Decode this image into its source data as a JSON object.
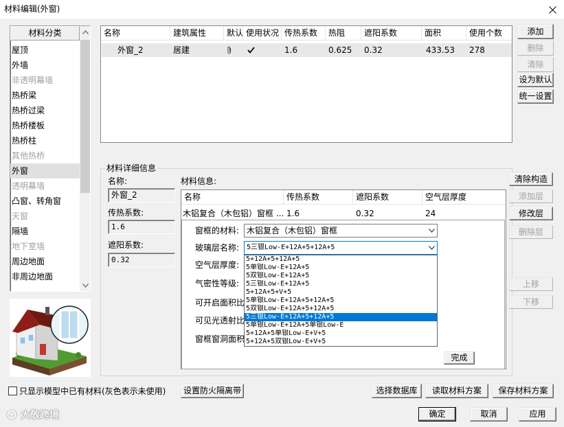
{
  "window": {
    "title": "材料编辑(外窗)"
  },
  "category_list": {
    "header": "材料分类",
    "selected_index": 8,
    "items": [
      {
        "label": "屋顶",
        "used": true
      },
      {
        "label": "外墙",
        "used": true
      },
      {
        "label": "非透明幕墙",
        "used": false
      },
      {
        "label": "热桥梁",
        "used": true
      },
      {
        "label": "热桥过梁",
        "used": true
      },
      {
        "label": "热桥楼板",
        "used": true
      },
      {
        "label": "热桥柱",
        "used": true
      },
      {
        "label": "其他热桥",
        "used": false
      },
      {
        "label": "外窗",
        "used": true
      },
      {
        "label": "透明幕墙",
        "used": false
      },
      {
        "label": "凸窗、转角窗",
        "used": true
      },
      {
        "label": "天窗",
        "used": false
      },
      {
        "label": "隔墙",
        "used": true
      },
      {
        "label": "地下室墙",
        "used": false
      },
      {
        "label": "周边地面",
        "used": true
      },
      {
        "label": "非周边地面",
        "used": true
      }
    ]
  },
  "materials_table": {
    "columns": [
      "名称",
      "建筑属性",
      "默认",
      "使用状况",
      "传热系数",
      "热阻",
      "遮阳系数",
      "面积",
      "使用个数"
    ],
    "rows": [
      {
        "name": "外窗_2",
        "attr": "居建",
        "default_icon": "paperclip-icon",
        "status_icon": "checkmark-icon",
        "u_value": "1.6",
        "resistance": "0.625",
        "shading": "0.32",
        "area": "433.53",
        "count": "278"
      }
    ]
  },
  "material_buttons": {
    "add": "添加",
    "delete": "删除",
    "clear": "清除",
    "set_default": "设为默认",
    "unify": "统一设置"
  },
  "detail": {
    "group_title": "材料详细信息",
    "name_label": "名称:",
    "name_value": "外窗_2",
    "u_label": "传热系数:",
    "u_value": "1.6",
    "shading_label": "遮阳系数:",
    "shading_value": "0.32",
    "info_label": "材料信息:",
    "layer_table": {
      "columns": [
        "名称",
        "传热系数",
        "遮阳系数",
        "空气层厚度"
      ],
      "rows": [
        {
          "name": "木铝复合（木包铝）窗框 ...",
          "u": "1.6",
          "shading": "0.32",
          "air": "24"
        }
      ]
    },
    "editor": {
      "frame_label": "窗框的材料:",
      "frame_value": "木铝复合（木包铝）窗框",
      "glass_label": "玻璃层名称:",
      "glass_value": "5三银Low-E+12A+5+12A+5",
      "glass_selected_index": 7,
      "glass_options": [
        "5+12A+5+12A+5",
        "5单银Low-E+12A+5",
        "5双银Low-E+12A+5",
        "5三银Low-E+12A+5",
        "5+12A+5+V+5",
        "5单银Low-E+12A+5+12A+5",
        "5双银Low-E+12A+5+12A+5",
        "5三银Low-E+12A+5+12A+5",
        "5单银Low-E+12A+5单银Low-E",
        "5+12A+5单银Low-E+V+5",
        "5+12A+5双银Low-E+V+5"
      ],
      "air_label": "空气层厚度:",
      "airtight_label": "气密性等级:",
      "open_ratio_label": "可开启面积比",
      "visible_trans_label": "可见光透射比",
      "frame_ratio_label": "窗框窗洞面积",
      "done": "完成"
    },
    "side_buttons": {
      "clear_construct": "清除构造",
      "add_layer": "添加层",
      "modify_layer": "修改层",
      "delete_layer": "删除层",
      "move_up": "上移",
      "move_down": "下移"
    }
  },
  "footer": {
    "only_model_checkbox": "只显示模型中已有材料(灰色表示未使用)",
    "only_model_checked": false,
    "fire_barrier": "设置防火隔离带",
    "select_db": "选择数据库",
    "load_scheme": "读取材料方案",
    "save_scheme": "保存材料方案",
    "ok": "确定",
    "cancel": "取消",
    "apply": "应用"
  },
  "watermark": "大敬跨境",
  "colors": {
    "selection": "#0078d7",
    "disabled_text": "#a0a0a0",
    "unused_text": "#a0a0a0",
    "roof": "#8e1f17",
    "lawn": "#4f9d2f"
  }
}
